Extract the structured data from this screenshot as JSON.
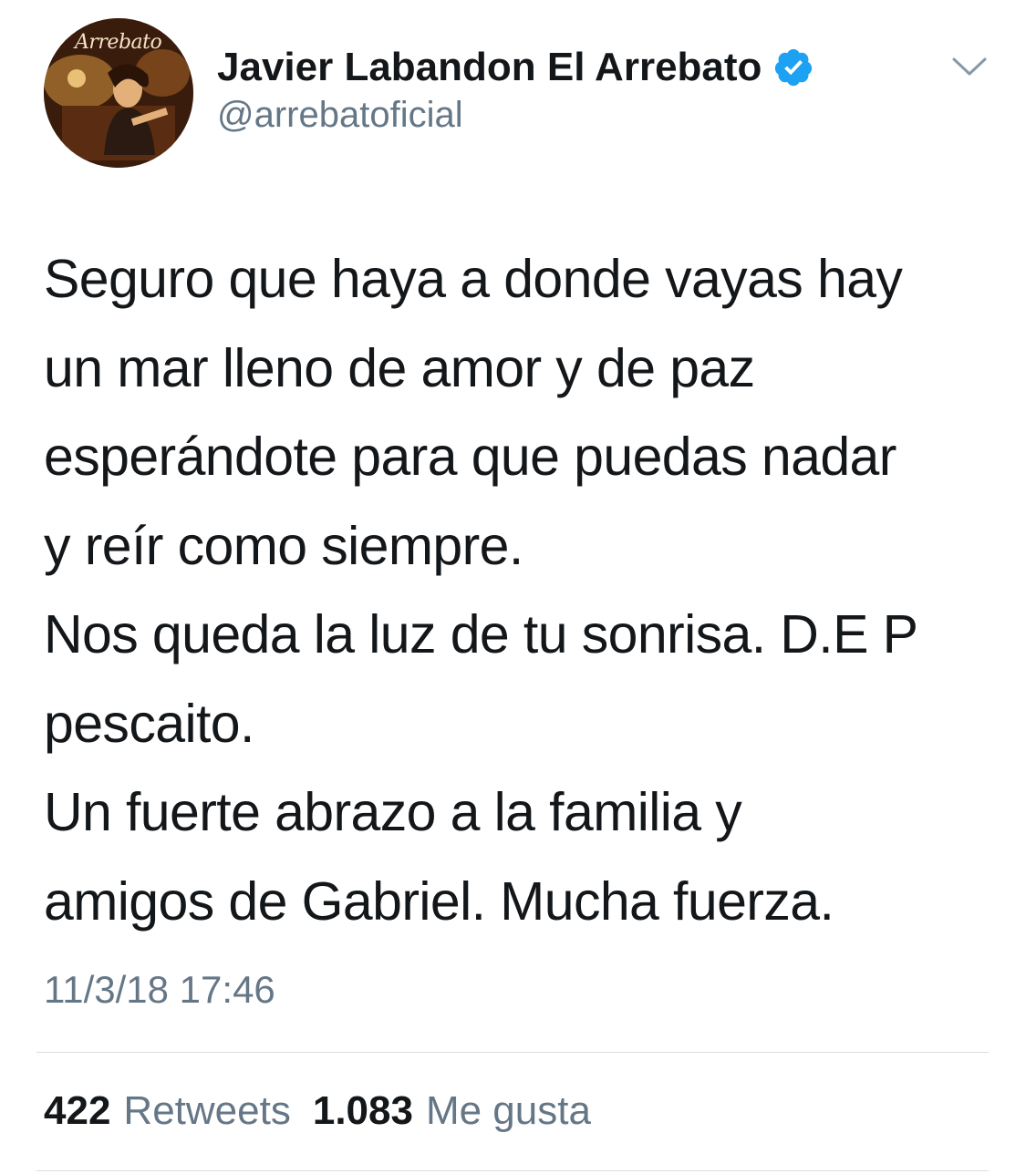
{
  "author": {
    "avatar_wordmark": "Arrebato",
    "display_name": "Javier Labandon El Arrebato",
    "handle": "@arrebatoficial",
    "verified": true
  },
  "icons": {
    "verified": "verified-badge-icon",
    "menu": "chevron-down-icon"
  },
  "tweet": {
    "lines": [
      "Seguro que haya a donde vayas hay",
      "un mar lleno de amor y de paz",
      "esperándote para que puedas nadar",
      "y reír como siempre.",
      "Nos queda la luz de tu sonrisa. D.E P",
      "pescaito.",
      "Un fuerte abrazo a la familia y",
      "amigos de Gabriel. Mucha fuerza."
    ],
    "timestamp": "11/3/18 17:46"
  },
  "stats": {
    "retweets_count": "422",
    "retweets_label": "Retweets",
    "likes_count": "1.083",
    "likes_label": "Me gusta"
  },
  "colors": {
    "text_primary": "#14171a",
    "text_secondary": "#657786",
    "verified_blue": "#1da1f2",
    "divider": "#d8dde1"
  }
}
